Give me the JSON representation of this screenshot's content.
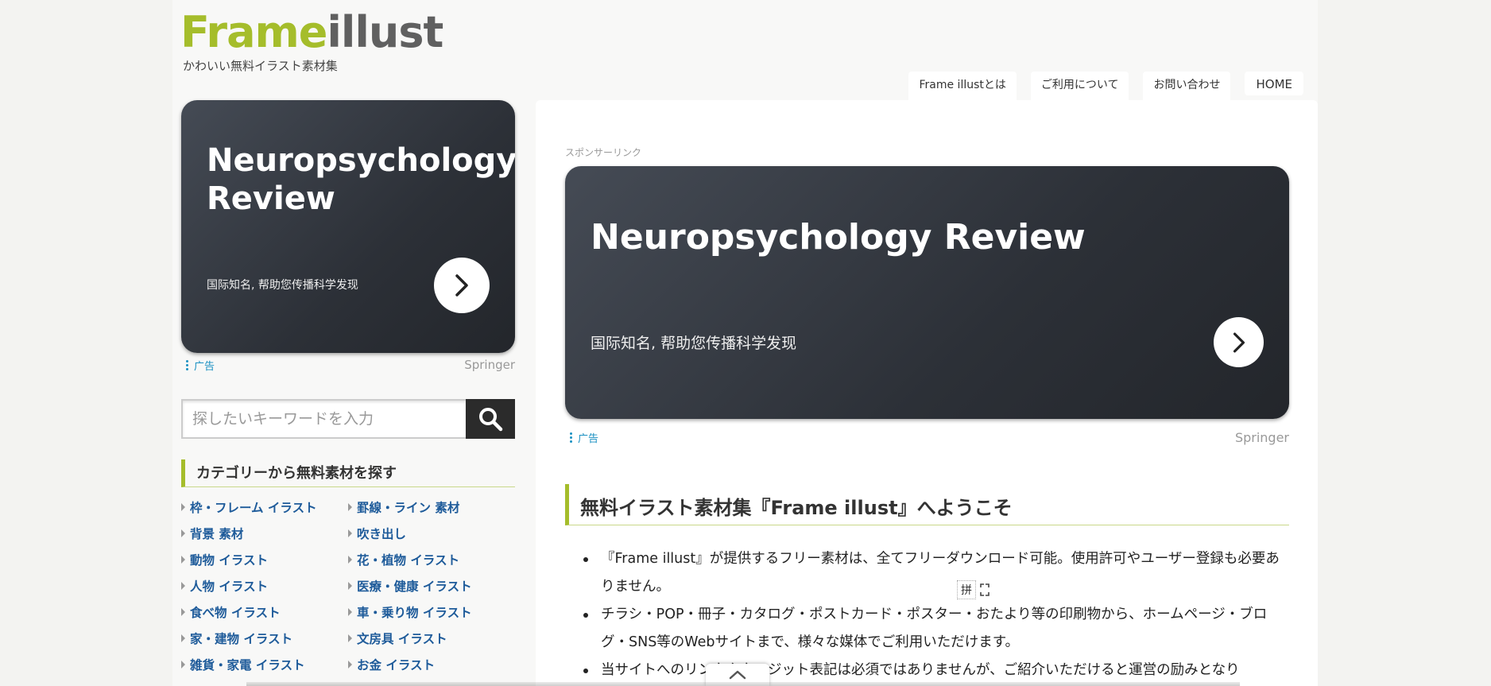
{
  "header": {
    "logo_frame": "Frame",
    "logo_illust": "illust",
    "tagline": "かわいい無料イラスト素材集",
    "nav": [
      "Frame illustとは",
      "ご利用について",
      "お問い合わせ",
      "HOME"
    ]
  },
  "sidebar_ad": {
    "title": "Neuropsychology Review",
    "description": "国际知名, 帮助您传播科学发现",
    "label": "广告",
    "source": "Springer"
  },
  "search": {
    "placeholder": "探したいキーワードを入力"
  },
  "categories": {
    "heading": "カテゴリーから無料素材を探す",
    "items": [
      "枠・フレーム イラスト",
      "罫線・ライン 素材",
      "背景 素材",
      "吹き出し",
      "動物 イラスト",
      "花・植物 イラスト",
      "人物 イラスト",
      "医療・健康 イラスト",
      "食べ物 イラスト",
      "車・乗り物 イラスト",
      "家・建物 イラスト",
      "文房具 イラスト",
      "雑貨・家電 イラスト",
      "お金 イラスト"
    ]
  },
  "main": {
    "sponsor_label": "スポンサーリンク",
    "ad": {
      "title": "Neuropsychology Review",
      "description": "国际知名, 帮助您传播科学发现",
      "label": "广告",
      "source": "Springer"
    },
    "welcome_heading": "無料イラスト素材集『Frame illust』へようこそ",
    "bullets": [
      "『Frame illust』が提供するフリー素材は、全てフリーダウンロード可能。使用許可やユーザー登録も必要ありません。",
      "チラシ・POP・冊子・カタログ・ポストカード・ポスター・おたより等の印刷物から、ホームページ・ブログ・SNS等のWebサイトまで、様々な媒体でご利用いただけます。",
      "当サイトへのリンクやクレジット表記は必須ではありませんが、ご紹介いただけると運営の励みとなり"
    ]
  },
  "ime": {
    "glyph": "拼"
  },
  "colors": {
    "accent": "#a5bd2b",
    "link": "#1e5b9a",
    "ad_label": "#1a90c2"
  }
}
